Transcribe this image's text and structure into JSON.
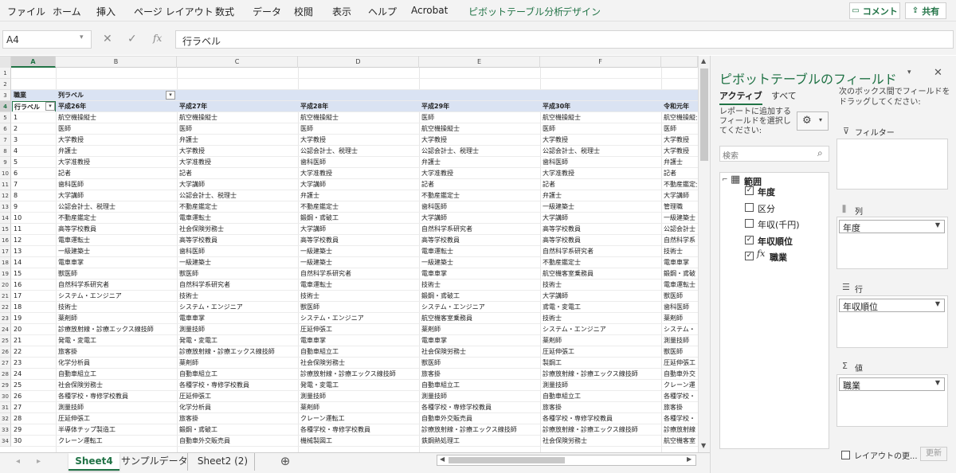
{
  "ribbon": {
    "tabs": [
      "ファイル",
      "ホーム",
      "挿入",
      "ページ レイアウト",
      "数式",
      "データ",
      "校閲",
      "表示",
      "ヘルプ",
      "Acrobat",
      "ピボットテーブル分析",
      "デザイン"
    ],
    "comment": "コメント",
    "share": "共有"
  },
  "formula": {
    "namebox": "A4",
    "fx": "fx",
    "content": "行ラベル"
  },
  "grid": {
    "columns": [
      "A",
      "B",
      "C",
      "D",
      "E",
      "F"
    ],
    "row_numbers": [
      "1",
      "2",
      "3",
      "4",
      "5",
      "6",
      "7",
      "8",
      "9",
      "10",
      "11",
      "12",
      "13",
      "14",
      "15",
      "16",
      "17",
      "18",
      "19",
      "20",
      "21",
      "22",
      "23",
      "24",
      "25",
      "26",
      "27",
      "28",
      "29",
      "30",
      "31",
      "32",
      "33",
      "34"
    ],
    "a3": "職業",
    "b3": "列ラベル",
    "a4": "行ラベル",
    "years": [
      "平成26年",
      "平成27年",
      "平成28年",
      "平成29年",
      "平成30年",
      "令和元年"
    ],
    "rows": [
      {
        "n": "1",
        "v": [
          "航空機操縦士",
          "航空機操縦士",
          "航空機操縦士",
          "医師",
          "航空機操縦士",
          "航空機操縦士"
        ]
      },
      {
        "n": "2",
        "v": [
          "医師",
          "医師",
          "医師",
          "航空機操縦士",
          "医師",
          "医師"
        ]
      },
      {
        "n": "3",
        "v": [
          "大学教授",
          "弁護士",
          "大学教授",
          "大学教授",
          "大学教授",
          "大学教授"
        ]
      },
      {
        "n": "4",
        "v": [
          "弁護士",
          "大学教授",
          "公認会計士、税理士",
          "公認会計士、税理士",
          "公認会計士、税理士",
          "大学教授"
        ]
      },
      {
        "n": "5",
        "v": [
          "大学准教授",
          "大学准教授",
          "歯科医師",
          "弁護士",
          "歯科医師",
          "弁護士"
        ]
      },
      {
        "n": "6",
        "v": [
          "記者",
          "記者",
          "大学准教授",
          "大学准教授",
          "大学准教授",
          "記者"
        ]
      },
      {
        "n": "7",
        "v": [
          "歯科医師",
          "大学講師",
          "大学講師",
          "記者",
          "記者",
          "不動産鑑定士"
        ]
      },
      {
        "n": "8",
        "v": [
          "大学講師",
          "公認会計士、税理士",
          "弁護士",
          "不動産鑑定士",
          "弁護士",
          "大学講師"
        ]
      },
      {
        "n": "9",
        "v": [
          "公認会計士、税理士",
          "不動産鑑定士",
          "不動産鑑定士",
          "歯科医師",
          "一級建築士",
          "管理職"
        ]
      },
      {
        "n": "10",
        "v": [
          "不動産鑑定士",
          "電車運転士",
          "鍛鋼・鳶破工",
          "大学講師",
          "大学講師",
          "一級建築士"
        ]
      },
      {
        "n": "11",
        "v": [
          "高等学校教員",
          "社会保険労務士",
          "大学講師",
          "自然科学系研究者",
          "高等学校教員",
          "公認会計士"
        ]
      },
      {
        "n": "12",
        "v": [
          "電車運転士",
          "高等学校教員",
          "高等学校教員",
          "高等学校教員",
          "高等学校教員",
          "自然科学系"
        ]
      },
      {
        "n": "13",
        "v": [
          "一級建築士",
          "歯科医師",
          "一級建築士",
          "電車運転士",
          "自然科学系研究者",
          "技術士"
        ]
      },
      {
        "n": "14",
        "v": [
          "電車車掌",
          "一級建築士",
          "一級建築士",
          "一級建築士",
          "不動産鑑定士",
          "電車車掌"
        ]
      },
      {
        "n": "15",
        "v": [
          "獣医師",
          "獣医師",
          "自然科学系研究者",
          "電車車掌",
          "航空機客室乗務員",
          "鍛鋼・鳶破"
        ]
      },
      {
        "n": "16",
        "v": [
          "自然科学系研究者",
          "自然科学系研究者",
          "電車運転士",
          "技術士",
          "技術士",
          "電車運転士"
        ]
      },
      {
        "n": "17",
        "v": [
          "システム・エンジニア",
          "技術士",
          "技術士",
          "鍛鋼・鳶破工",
          "大学講師",
          "獣医師"
        ]
      },
      {
        "n": "18",
        "v": [
          "技術士",
          "システム・エンジニア",
          "獣医師",
          "システム・エンジニア",
          "鳶電・変電工",
          "歯科医師"
        ]
      },
      {
        "n": "19",
        "v": [
          "薬剤師",
          "電車車掌",
          "システム・エンジニア",
          "航空機客室乗務員",
          "技術士",
          "薬剤師"
        ]
      },
      {
        "n": "20",
        "v": [
          "診療放射線・診療エックス線技師",
          "測量技師",
          "圧延伸張工",
          "薬剤師",
          "システム・エンジニア",
          "システム・"
        ]
      },
      {
        "n": "21",
        "v": [
          "発電・変電工",
          "発電・変電工",
          "電車車掌",
          "電車車掌",
          "薬剤師",
          "測量技師"
        ]
      },
      {
        "n": "22",
        "v": [
          "旅客掛",
          "診療放射線・診療エックス線技師",
          "自動車組立工",
          "社会保険労務士",
          "圧延伸張工",
          "獣医師"
        ]
      },
      {
        "n": "23",
        "v": [
          "化学分析員",
          "薬剤師",
          "社会保険労務士",
          "獣医師",
          "製鋼工",
          "圧延伸張工"
        ]
      },
      {
        "n": "24",
        "v": [
          "自動車組立工",
          "自動車組立工",
          "診療放射線・診療エックス線技師",
          "旅客掛",
          "診療放射線・診療エックス線技師",
          "自動車外交"
        ]
      },
      {
        "n": "25",
        "v": [
          "社会保険労務士",
          "各種学校・専修学校教員",
          "発電・変電工",
          "自動車組立工",
          "測量技師",
          "クレーン運"
        ]
      },
      {
        "n": "26",
        "v": [
          "各種学校・専修学校教員",
          "圧延伸張工",
          "測量技師",
          "測量技師",
          "自動車組立工",
          "各種学校・"
        ]
      },
      {
        "n": "27",
        "v": [
          "測量技師",
          "化学分析員",
          "薬剤師",
          "各種学校・専修学校教員",
          "旅客掛",
          "旅客掛"
        ]
      },
      {
        "n": "28",
        "v": [
          "圧延伸張工",
          "旅客掛",
          "クレーン運転工",
          "自動車外交販売員",
          "各種学校・専修学校教員",
          "各種学校・"
        ]
      },
      {
        "n": "29",
        "v": [
          "半導体チップ製造工",
          "鍛鋼・鳶破工",
          "各種学校・専修学校教員",
          "診療放射線・診療エックス線技師",
          "診療放射線・診療エックス線技師",
          "診療放射線"
        ]
      },
      {
        "n": "30",
        "v": [
          "クレーン運転工",
          "自動車外交販売員",
          "機械製図工",
          "鉄鋼熱処理工",
          "社会保険労務士",
          "航空機客室"
        ]
      }
    ]
  },
  "sheets": {
    "tabs": [
      "Sheet4",
      "サンプルデータ",
      "Sheet2 (2)"
    ],
    "add": "⊕"
  },
  "pane": {
    "title": "ピボットテーブルのフィールド",
    "tab_active": "アクティブ",
    "tab_all": "すべて",
    "instruction": "レポートに追加するフィールドを選択してください:",
    "search_placeholder": "検索",
    "range_label": "範囲",
    "fields": [
      {
        "label": "年度",
        "checked": true
      },
      {
        "label": "区分",
        "checked": false
      },
      {
        "label": "年収(千円)",
        "checked": false
      },
      {
        "label": "年収順位",
        "checked": true
      },
      {
        "label": "職業",
        "checked": true
      }
    ],
    "drag_hint": "次のボックス間でフィールドをドラッグしてください:",
    "filters": "フィルター",
    "columns": "列",
    "rows": "行",
    "values": "値",
    "col_value": "年度",
    "row_value": "年収順位",
    "val_value": "職業",
    "defer": "レイアウトの更...",
    "update": "更新"
  }
}
